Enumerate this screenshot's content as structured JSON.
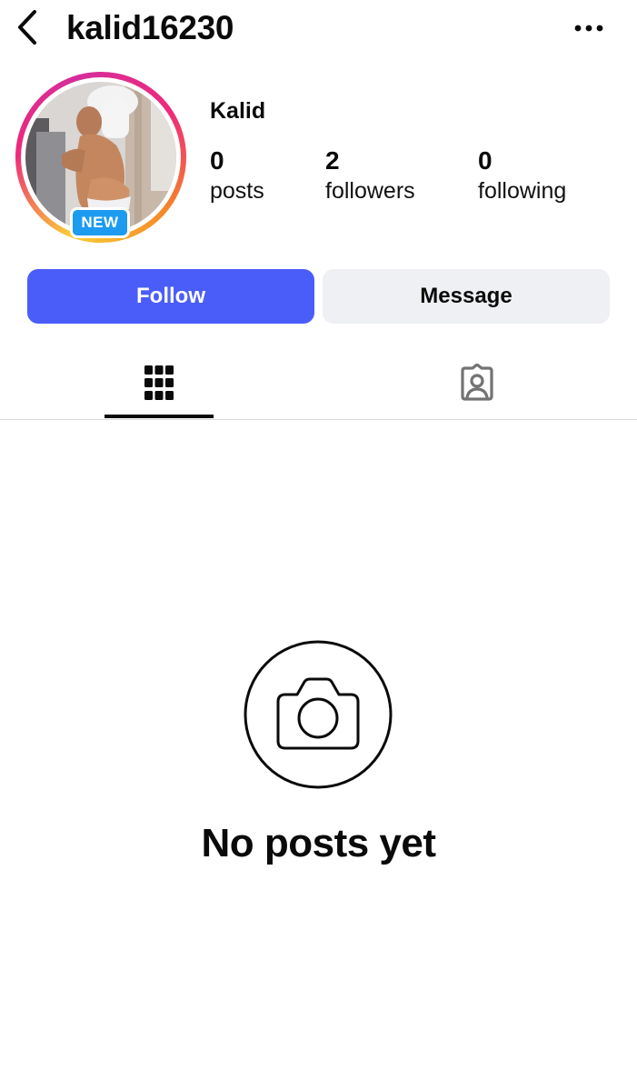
{
  "header": {
    "username": "kalid16230",
    "back_icon": "chevron-left-icon",
    "more_icon": "more-horizontal-icon"
  },
  "profile": {
    "display_name": "Kalid",
    "badge": "NEW",
    "stats": [
      {
        "value": "0",
        "label": "posts"
      },
      {
        "value": "2",
        "label": "followers"
      },
      {
        "value": "0",
        "label": "following"
      }
    ]
  },
  "actions": {
    "follow_label": "Follow",
    "message_label": "Message"
  },
  "tabs": {
    "items": [
      {
        "icon": "grid-icon",
        "active": true
      },
      {
        "icon": "tagged-user-icon",
        "active": false
      }
    ]
  },
  "empty_state": {
    "icon": "camera-icon",
    "title": "No posts yet"
  },
  "colors": {
    "follow_button": "#4a5df9",
    "message_button": "#eff0f4",
    "badge": "#1d9bf0",
    "text": "#0a0a0a"
  }
}
